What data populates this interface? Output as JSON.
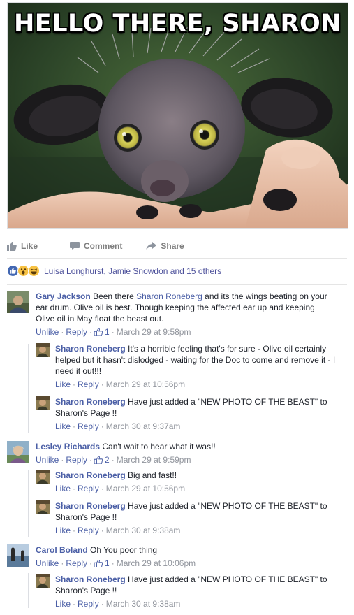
{
  "meme": {
    "caption": "HELLO THERE, SHARON",
    "subject": "aye-aye held in a hand"
  },
  "actions": {
    "like": "Like",
    "comment": "Comment",
    "share": "Share"
  },
  "reactions": {
    "icons": [
      "like-icon",
      "wow-icon",
      "haha-icon"
    ],
    "names": "Luisa Longhurst, Jamie Snowdon and 15 others"
  },
  "comments": [
    {
      "author": "Gary Jackson",
      "pre": "Been there ",
      "mention": "Sharon Roneberg",
      "text": " and its the wings beating on your ear drum. Olive oil is best. Though keeping the affected ear up and keeping Olive oil in May float the beast out.",
      "action1": "Unlike",
      "action2": "Reply",
      "likes": "1",
      "time": "March 29 at 9:58pm",
      "replies": [
        {
          "author": "Sharon Roneberg",
          "text": "It's a horrible feeling that's for sure - Olive oil certainly helped but it hasn't dislodged - waiting for the Doc to come and remove it - I need it out!!!",
          "action1": "Like",
          "action2": "Reply",
          "time": "March 29 at 10:56pm"
        },
        {
          "author": "Sharon Roneberg",
          "text": "Have just added a \"NEW PHOTO OF THE BEAST\" to Sharon's Page !!",
          "action1": "Like",
          "action2": "Reply",
          "time": "March 30 at 9:37am"
        }
      ]
    },
    {
      "author": "Lesley Richards",
      "text": "Can't wait to hear what it was!!",
      "action1": "Unlike",
      "action2": "Reply",
      "likes": "2",
      "time": "March 29 at 9:59pm",
      "replies": [
        {
          "author": "Sharon Roneberg",
          "text": "Big and fast!!",
          "action1": "Like",
          "action2": "Reply",
          "time": "March 29 at 10:56pm"
        },
        {
          "author": "Sharon Roneberg",
          "text": "Have just added a \"NEW PHOTO OF THE BEAST\" to Sharon's Page !!",
          "action1": "Like",
          "action2": "Reply",
          "time": "March 30 at 9:38am"
        }
      ]
    },
    {
      "author": "Carol Boland",
      "text": "Oh You poor thing",
      "action1": "Unlike",
      "action2": "Reply",
      "likes": "1",
      "time": "March 29 at 10:06pm",
      "replies": [
        {
          "author": "Sharon Roneberg",
          "text": "Have just added a \"NEW PHOTO OF THE BEAST\" to Sharon's Page !!",
          "action1": "Like",
          "action2": "Reply",
          "time": "March 30 at 9:38am"
        }
      ]
    }
  ],
  "colors": {
    "link": "#4b5fa6",
    "meta": "#90949c",
    "action": "#7f7f7f",
    "like_blue": "#4267b2"
  }
}
